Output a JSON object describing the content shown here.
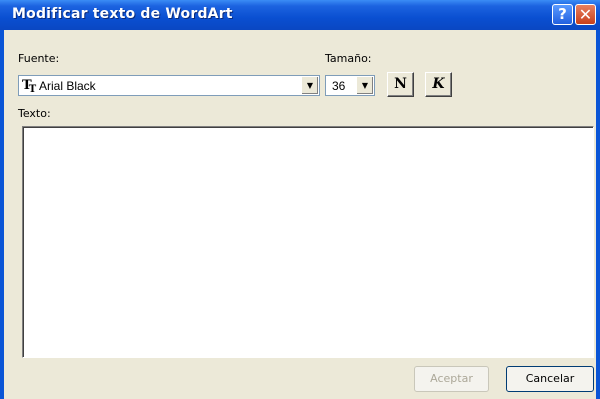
{
  "window": {
    "title": "Modificar texto de WordArt",
    "help_label": "?",
    "close_label": "✕"
  },
  "font": {
    "label": "Fuente:",
    "value": "Arial Black",
    "icon": "truetype-icon"
  },
  "size": {
    "label": "Tamaño:",
    "value": "36"
  },
  "format": {
    "bold_label": "N",
    "italic_label": "K"
  },
  "text": {
    "label": "Texto:",
    "value": ""
  },
  "buttons": {
    "accept_label": "Aceptar",
    "cancel_label": "Cancelar"
  }
}
